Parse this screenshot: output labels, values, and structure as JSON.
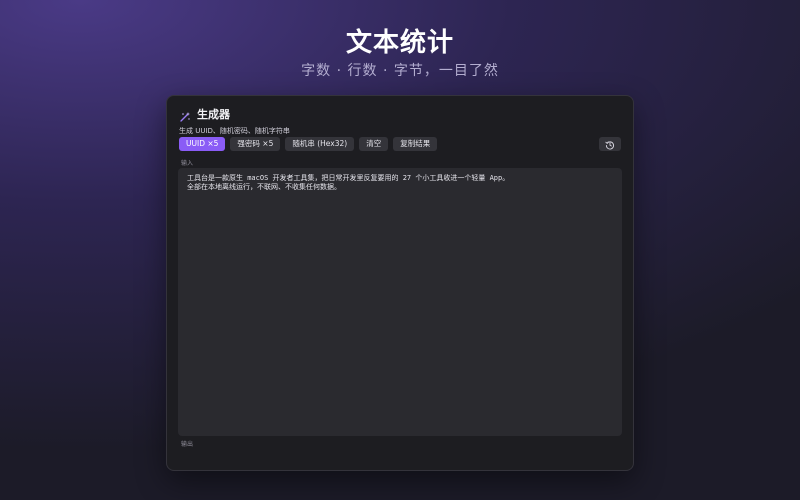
{
  "hero": {
    "title": "文本统计",
    "subtitle": "字数 · 行数 · 字节，一目了然"
  },
  "panel": {
    "title": "生成器",
    "description": "生成 UUID、随机密码、随机字符串",
    "icon": "magic-wand-icon",
    "accent_color": "#8a5cf6"
  },
  "toolbar": {
    "buttons": [
      {
        "label": "UUID ×5",
        "active": true
      },
      {
        "label": "强密码 ×5",
        "active": false
      },
      {
        "label": "随机串 (Hex32)",
        "active": false
      },
      {
        "label": "清空",
        "active": false
      },
      {
        "label": "复制结果",
        "active": false
      }
    ],
    "history_icon": "history-icon"
  },
  "input": {
    "label": "输入",
    "lines": [
      "工具台是一款原生 macOS 开发者工具集，把日常开发里反复要用的 27 个小工具收进一个轻量 App。",
      "全部在本地离线运行，不联网、不收集任何数据。"
    ]
  },
  "output": {
    "label": "输出"
  }
}
